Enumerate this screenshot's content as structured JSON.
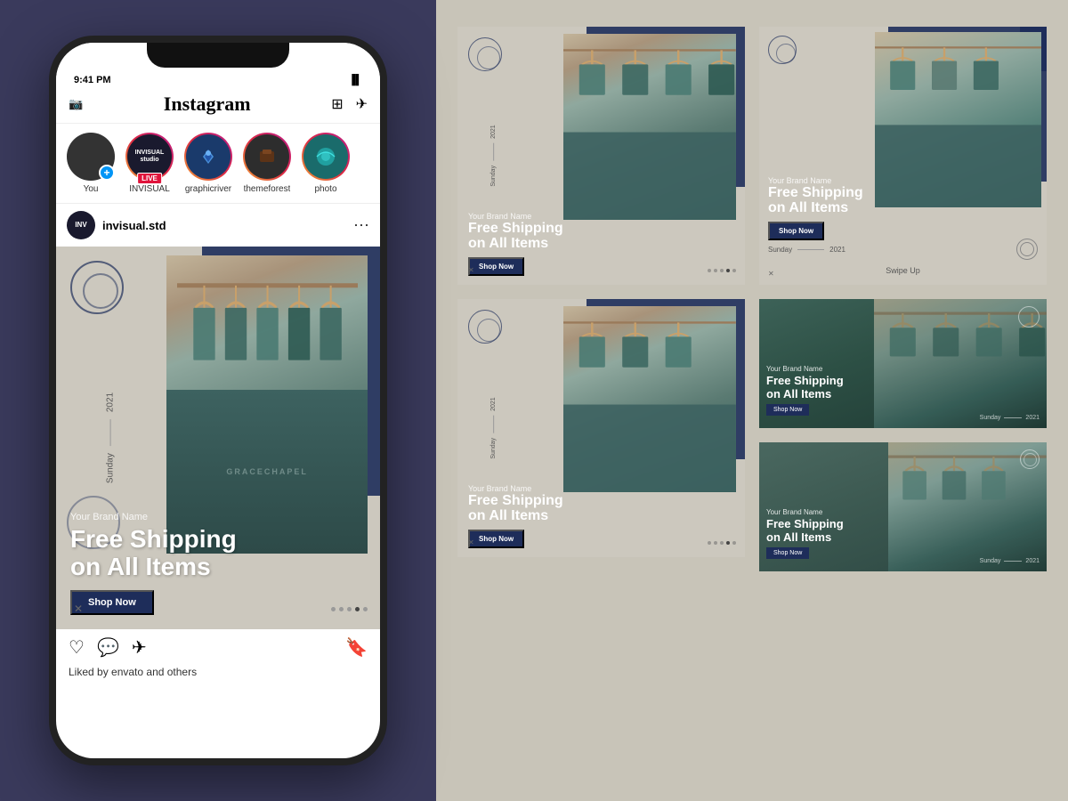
{
  "app": {
    "name": "Instagram"
  },
  "phone": {
    "time": "9:41 PM",
    "battery": "■■■"
  },
  "instagram": {
    "stories": [
      {
        "label": "You",
        "type": "you"
      },
      {
        "label": "INVISUAL\nstudio",
        "type": "brand",
        "live": false
      },
      {
        "label": "graphicriver",
        "type": "has-story"
      },
      {
        "label": "themeforest",
        "type": "has-story"
      },
      {
        "label": "photo",
        "type": "has-story"
      }
    ],
    "post": {
      "username": "invisual.std",
      "brand_name": "Your Brand Name",
      "headline_line1": "Free Shipping",
      "headline_line2": "on All Items",
      "shop_now": "Shop Now",
      "sunday": "Sunday",
      "year": "2021",
      "liked_by": "Liked by envato and others"
    }
  },
  "templates": {
    "brand_name": "Your Brand Name",
    "headline_1": "Free Shipping",
    "headline_2": "on All Items",
    "shop_now": "Shop Now",
    "sunday": "Sunday",
    "year": "2021",
    "swipe_up": "Swipe Up"
  },
  "colors": {
    "dark_blue": "#1e2d5a",
    "bg_light": "#c8c4b8",
    "card_bg": "#d4d0c8",
    "text_main": "#fff"
  }
}
